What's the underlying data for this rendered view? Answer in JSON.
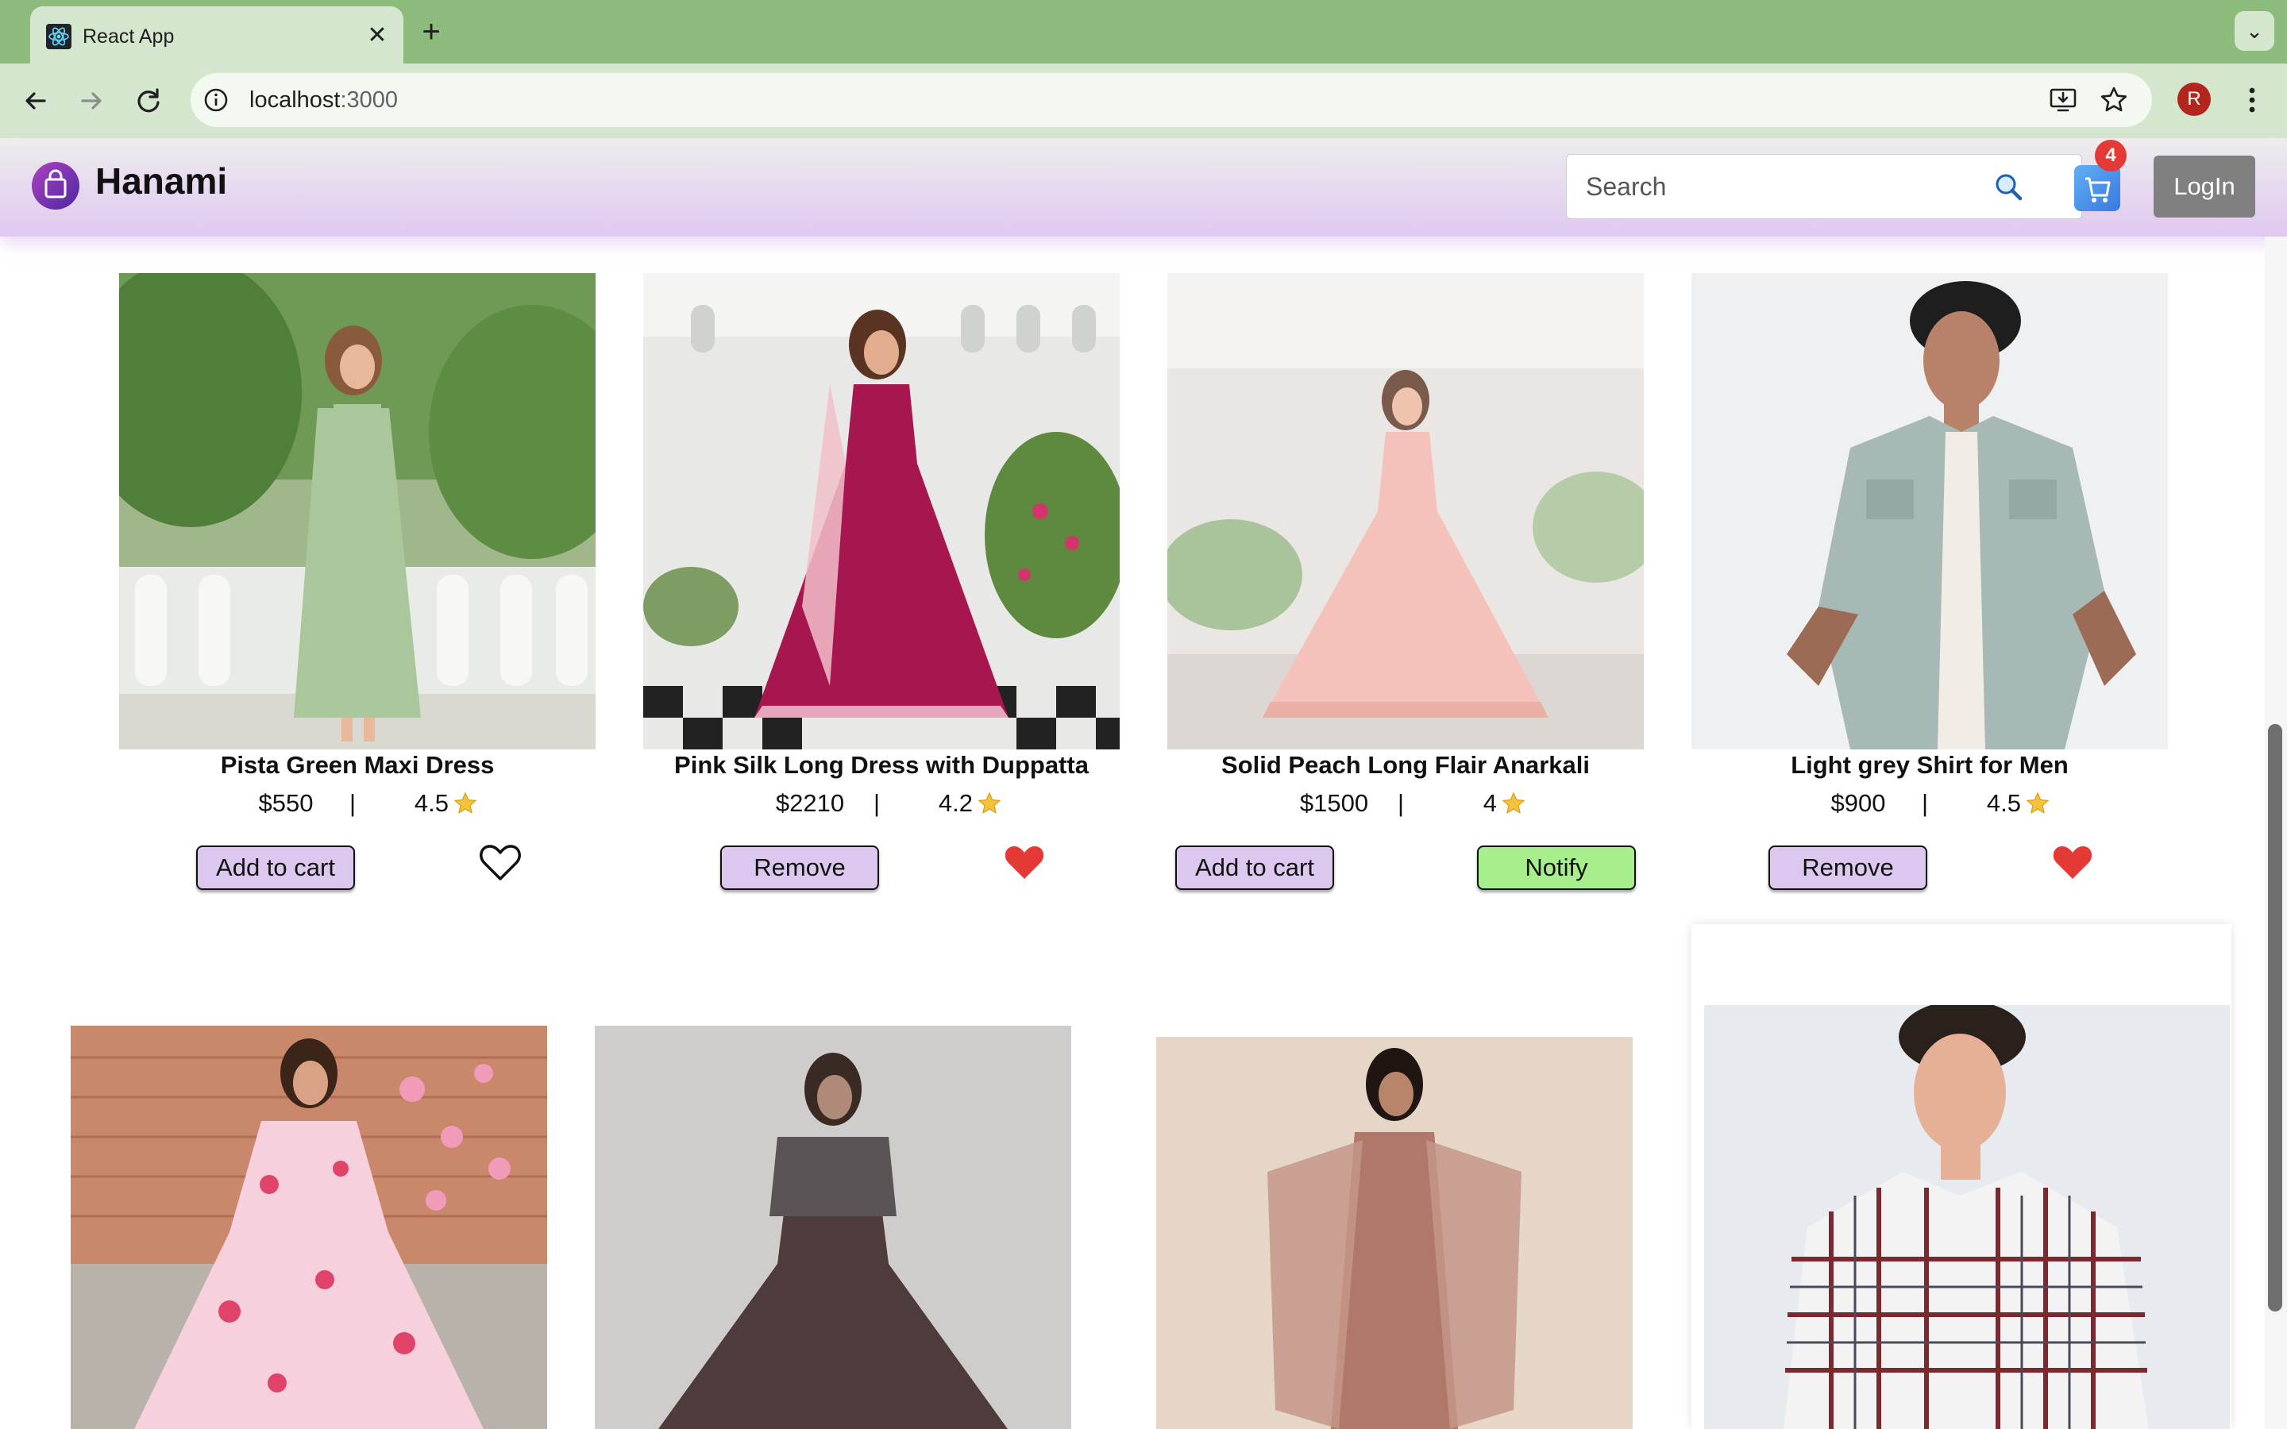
{
  "browser": {
    "tab_title": "React App",
    "close_symbol": "✕",
    "new_tab_symbol": "+",
    "tab_menu_symbol": "⌄",
    "url_host": "localhost",
    "url_port": ":3000",
    "profile_initial": "R"
  },
  "header": {
    "brand": "Hanami",
    "search_placeholder": "Search",
    "cart_count": "4",
    "login_label": "LogIn"
  },
  "colors": {
    "header_gradient_start": "#ededed",
    "header_gradient_end": "#e0c8f2",
    "add_to_cart_bg": "#dcc7ef",
    "notify_bg": "#a6ef8c",
    "heart_red": "#e53935",
    "login_bg": "#808080"
  },
  "products": [
    {
      "name": "Pista Green Maxi Dress",
      "price": "$550",
      "separator": "|",
      "rating": "4.5",
      "button": "Add to cart",
      "liked": false
    },
    {
      "name": "Pink Silk Long Dress with Duppatta",
      "price": "$2210",
      "separator": "|",
      "rating": "4.2",
      "button": "Remove",
      "liked": true
    },
    {
      "name": "Solid Peach Long Flair Anarkali",
      "price": "$1500",
      "separator": "|",
      "rating": "4",
      "button": "Add to cart",
      "notify_label": "Notify"
    },
    {
      "name": "Light grey Shirt for Men",
      "price": "$900",
      "separator": "|",
      "rating": "4.5",
      "button": "Remove",
      "liked": true
    }
  ]
}
